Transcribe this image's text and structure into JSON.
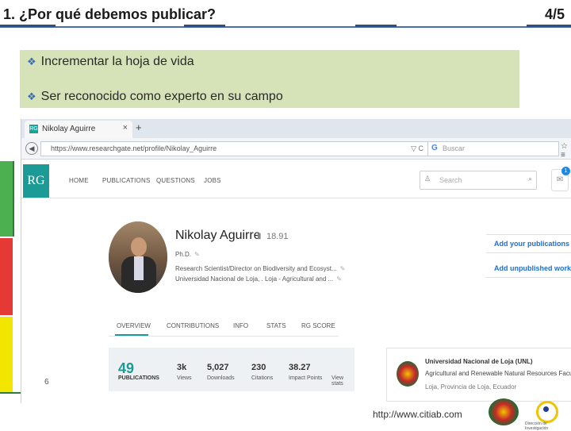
{
  "slide": {
    "title": "1. ¿Por qué debemos publicar?",
    "page": "4/5",
    "bullets": [
      "Incrementar la hoja de vida",
      "Ser reconocido como experto en su campo"
    ],
    "slide_number": "6",
    "footer_url": "http://www.citiab.com",
    "logo_text": "Dirección de Investigación"
  },
  "browser": {
    "tab_label": "Nikolay Aguirre",
    "tab_close": "×",
    "new_tab": "+",
    "url": "https://www.researchgate.net/profile/Nikolay_Aguirre",
    "url_tools": "▽ C",
    "search_placeholder": "Buscar",
    "toolbar_icons": "☆ ≡"
  },
  "rg": {
    "logo": "RG",
    "nav": [
      "HOME",
      "PUBLICATIONS",
      "QUESTIONS",
      "JOBS"
    ],
    "search_placeholder": "Search",
    "badge": "1"
  },
  "profile": {
    "name": "Nikolay Aguirre",
    "score": "18.91",
    "degree": "Ph.D.",
    "position": "Research Scientist/Director on Biodiversity and Ecosyst...",
    "affiliation": "Universidad Nacional de Loja, . Loja - Agricultural and ...",
    "actions": [
      "Add your publications",
      "Add unpublished work"
    ],
    "tabs": [
      "OVERVIEW",
      "CONTRIBUTIONS",
      "INFO",
      "STATS",
      "RG SCORE"
    ]
  },
  "stats": {
    "publications": "49",
    "publications_label": "PUBLICATIONS",
    "items": [
      {
        "value": "3k",
        "label": "Views"
      },
      {
        "value": "5,027",
        "label": "Downloads"
      },
      {
        "value": "230",
        "label": "Citations"
      },
      {
        "value": "38.27",
        "label": "Impact Points"
      }
    ],
    "view_stats": "View stats"
  },
  "institution": {
    "name": "Universidad Nacional de Loja (UNL)",
    "department": "Agricultural and Renewable Natural Resources Facu...",
    "location": "Loja, Provincia de Loja, Ecuador"
  }
}
